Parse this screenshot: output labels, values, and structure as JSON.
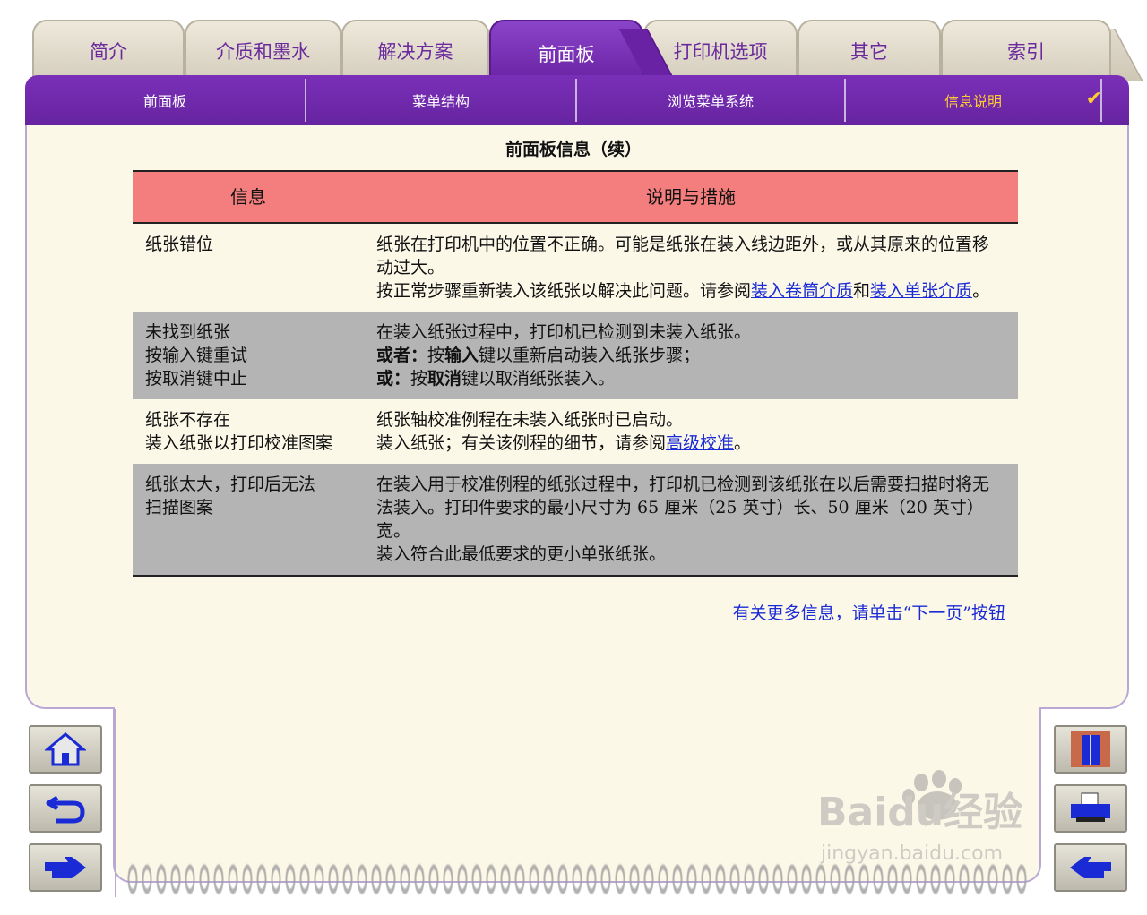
{
  "tabs": [
    {
      "label": "简介"
    },
    {
      "label": "介质和墨水"
    },
    {
      "label": "解决方案"
    },
    {
      "label": "前面板"
    },
    {
      "label": "打印机选项"
    },
    {
      "label": "其它"
    },
    {
      "label": "索引"
    }
  ],
  "active_tab": "前面板",
  "subnav": {
    "items": [
      {
        "label": "前面板"
      },
      {
        "label": "菜单结构"
      },
      {
        "label": "浏览菜单系统"
      },
      {
        "label": "信息说明"
      }
    ],
    "current": "信息说明",
    "check_glyph": "✔"
  },
  "page": {
    "title": "前面板信息（续）",
    "more_info": "有关更多信息，请单击“下一页”按钮"
  },
  "table": {
    "headers": {
      "col1": "信息",
      "col2": "说明与措施"
    },
    "rows": [
      {
        "msg": [
          "纸张错位"
        ],
        "desc1": "纸张在打印机中的位置不正确。可能是纸张在装入线边距外，或从其原来的位置移动过大。",
        "desc2_pre": "按正常步骤重新装入该纸张以解决此问题。请参阅",
        "link1": "装入卷筒介质",
        "mid": "和",
        "link2": "装入单张介质",
        "end": "。"
      },
      {
        "msg": [
          "未找到纸张",
          "按输入键重试",
          "按取消键中止"
        ],
        "desc1": "在装入纸张过程中，打印机已检测到未装入纸张。",
        "l2_bold1": "或者：",
        "l2_t1": "按",
        "l2_bold2": "输入",
        "l2_t2": "键以重新启动装入纸张步骤；",
        "l3_bold1": "或：",
        "l3_t1": "按",
        "l3_bold2": "取消",
        "l3_t2": "键以取消纸张装入。"
      },
      {
        "msg": [
          "纸张不存在",
          "装入纸张以打印校准图案"
        ],
        "desc1": "纸张轴校准例程在未装入纸张时已启动。",
        "desc2_pre": "装入纸张；有关该例程的细节，请参阅",
        "link1": "高级校准",
        "end": "。"
      },
      {
        "msg": [
          "纸张太大，打印后无法",
          "扫描图案"
        ],
        "desc1": "在装入用于校准例程的纸张过程中，打印机已检测到该纸张在以后需要扫描时将无法装入。打印件要求的最小尺寸为 65 厘米（25 英寸）长、50 厘米（20 英寸）宽。",
        "desc2": "装入符合此最低要求的更小单张纸张。"
      }
    ]
  },
  "colors": {
    "accent_purple": "#6a22a4",
    "header_salmon": "#f47e7e",
    "row_grey": "#b4b4b4",
    "link_blue": "#1a2bd6",
    "panel_cream": "#fcf8e8"
  },
  "icons": {
    "left": [
      "home-icon",
      "back-icon",
      "next-page-icon"
    ],
    "right": [
      "exit-door-icon",
      "printer-icon",
      "next-page-icon"
    ]
  },
  "watermark": {
    "brand": "Baidu经验",
    "url": "jingyan.baidu.com"
  }
}
